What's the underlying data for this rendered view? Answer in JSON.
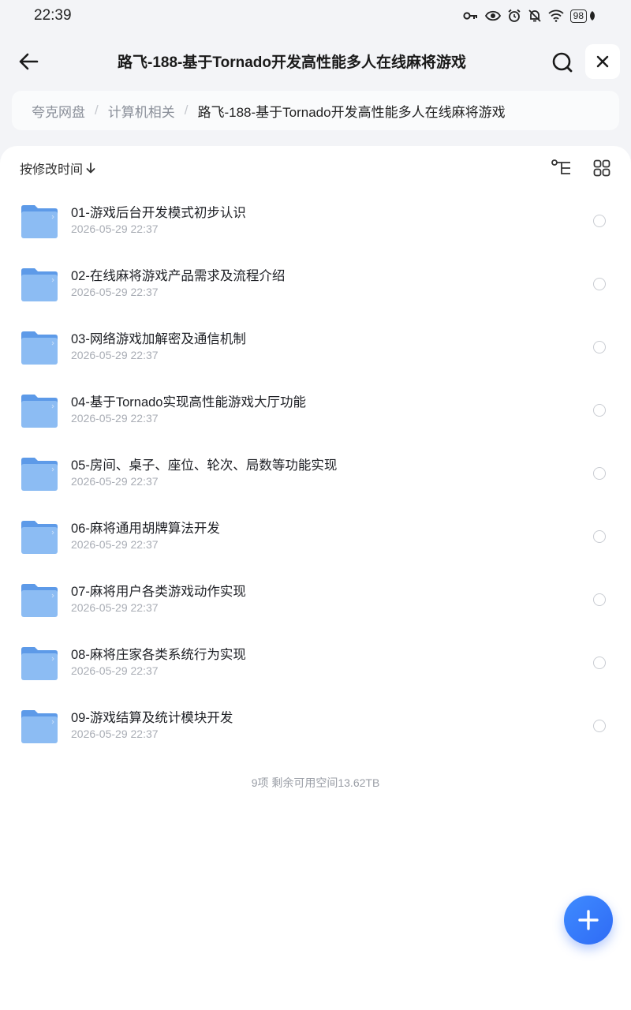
{
  "status_bar": {
    "time": "22:39",
    "battery": "98",
    "icons": [
      "key-icon",
      "eye-icon",
      "alarm-icon",
      "mute-bell-icon",
      "wifi-icon",
      "battery-icon",
      "leaf-icon"
    ]
  },
  "header": {
    "title": "路飞-188-基于Tornado开发高性能多人在线麻将游戏",
    "back_icon": "arrow-left-icon",
    "search_icon": "search-icon",
    "close_icon": "close-icon"
  },
  "breadcrumb": {
    "items": [
      "夸克网盘",
      "计算机相关",
      "路飞-188-基于Tornado开发高性能多人在线麻将游戏"
    ],
    "separator": "/"
  },
  "toolbar": {
    "sort_label": "按修改时间",
    "sort_icon": "arrow-down-icon",
    "tree_icon": "tree-view-icon",
    "grid_icon": "grid-view-icon"
  },
  "files": [
    {
      "name": "01-游戏后台开发模式初步认识",
      "date": "2026-05-29 22:37"
    },
    {
      "name": "02-在线麻将游戏产品需求及流程介绍",
      "date": "2026-05-29 22:37"
    },
    {
      "name": "03-网络游戏加解密及通信机制",
      "date": "2026-05-29 22:37"
    },
    {
      "name": "04-基于Tornado实现高性能游戏大厅功能",
      "date": "2026-05-29 22:37"
    },
    {
      "name": "05-房间、桌子、座位、轮次、局数等功能实现",
      "date": "2026-05-29 22:37"
    },
    {
      "name": "06-麻将通用胡牌算法开发",
      "date": "2026-05-29 22:37"
    },
    {
      "name": "07-麻将用户各类游戏动作实现",
      "date": "2026-05-29 22:37"
    },
    {
      "name": "08-麻将庄家各类系统行为实现",
      "date": "2026-05-29 22:37"
    },
    {
      "name": "09-游戏结算及统计模块开发",
      "date": "2026-05-29 22:37"
    }
  ],
  "footer": {
    "summary": "9项 剩余可用空间13.62TB"
  },
  "fab": {
    "icon": "plus-icon"
  },
  "colors": {
    "accent": "#2f6bf5",
    "folder": "#8cbcf3",
    "background": "#f3f4f7"
  }
}
